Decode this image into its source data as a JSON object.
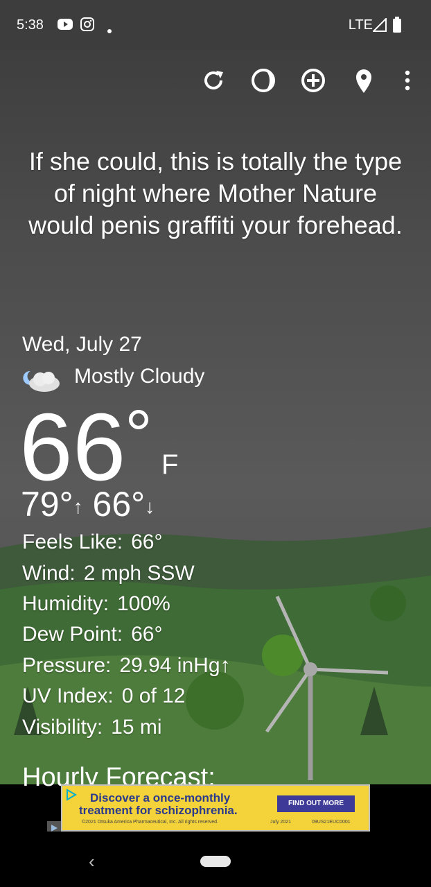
{
  "status_bar": {
    "time": "5:38",
    "network": "LTE"
  },
  "quote": "If she could, this is totally the type of night where Mother Nature would penis graffiti your forehead.",
  "weather": {
    "date": "Wed, July 27",
    "condition": "Mostly Cloudy",
    "temperature": "66",
    "degree_symbol": "°",
    "unit": "F",
    "high": "79°",
    "high_arrow": "↑",
    "low": "66°",
    "low_arrow": "↓",
    "details": [
      {
        "label": "Feels Like:",
        "value": "66°"
      },
      {
        "label": "Wind:",
        "value": "2 mph SSW"
      },
      {
        "label": "Humidity:",
        "value": "100%"
      },
      {
        "label": "Dew Point:",
        "value": "66°"
      },
      {
        "label": "Pressure:",
        "value": "29.94 inHg↑"
      },
      {
        "label": "UV Index:",
        "value": "0 of 12"
      },
      {
        "label": "Visibility:",
        "value": "15 mi"
      }
    ],
    "hourly_title": "Hourly Forecast:"
  },
  "ad": {
    "line1": "Discover a once-monthly",
    "line2": "treatment for schizophrenia.",
    "cta": "FIND OUT MORE",
    "copyright": "©2021 Otsuka America Pharmaceutical, Inc. All rights reserved.",
    "date": "July 2021",
    "code": "09US21EUC0001"
  },
  "icons": {
    "refresh": "refresh-icon",
    "moon": "moon-phase-icon",
    "add": "add-location-icon",
    "pin": "location-pin-icon",
    "menu": "more-vert-icon"
  }
}
